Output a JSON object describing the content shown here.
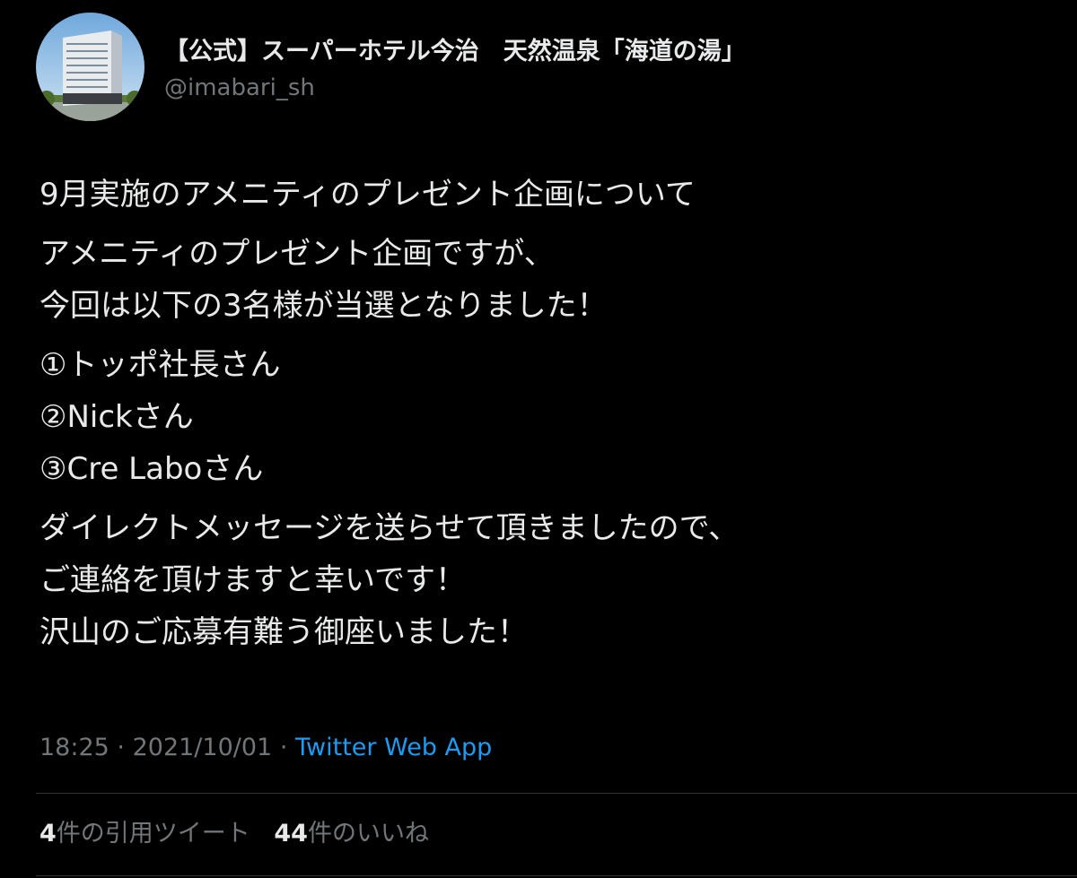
{
  "author": {
    "display_name": "【公式】スーパーホテル今治　天然温泉「海道の湯」",
    "handle": "@imabari_sh"
  },
  "tweet": {
    "paragraphs": [
      [
        "9月実施のアメニティのプレゼント企画について"
      ],
      [
        "アメニティのプレゼント企画ですが、",
        "今回は以下の3名様が当選となりました！"
      ],
      [
        "①トッポ社長さん",
        "②Nickさん",
        "③Cre Laboさん"
      ],
      [
        "ダイレクトメッセージを送らせて頂きましたので、",
        "ご連絡を頂けますと幸いです！",
        "沢山のご応募有難う御座いました！"
      ]
    ]
  },
  "meta": {
    "time": "18:25",
    "separator": "·",
    "date": "2021/10/01",
    "source": "Twitter Web App"
  },
  "stats": {
    "quote_count": "4",
    "quote_label": "件の引用ツイート",
    "like_count": "44",
    "like_label": "件のいいね"
  },
  "colors": {
    "background": "#000000",
    "text": "#e7e9ea",
    "secondary": "#71767b",
    "link": "#1d9bf0",
    "divider": "#2f3336"
  }
}
